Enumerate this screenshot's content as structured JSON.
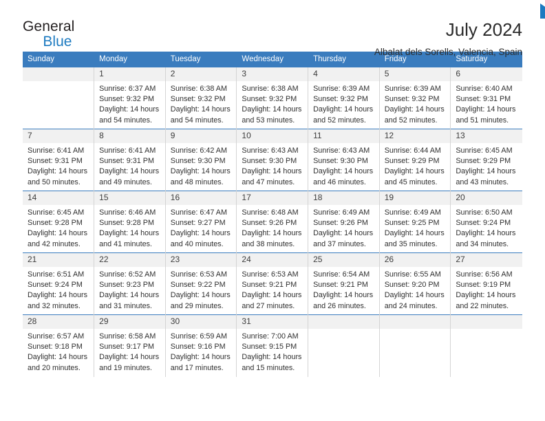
{
  "brand": {
    "name_top": "General",
    "name_bottom": "Blue",
    "triangle_icon": "triangle-icon",
    "color_top": "#231f20",
    "color_bottom": "#1c7ac0"
  },
  "header": {
    "title": "July 2024",
    "subtitle": "Albalat dels Sorells, Valencia, Spain"
  },
  "theme": {
    "header_bar": "#3a7cbe",
    "daynum_band": "#f1f1f1",
    "grid_line": "#d4d4d4",
    "text": "#2f2f2f"
  },
  "weekday_headers": [
    "Sunday",
    "Monday",
    "Tuesday",
    "Wednesday",
    "Thursday",
    "Friday",
    "Saturday"
  ],
  "weeks": [
    [
      {
        "day": "",
        "sunrise": "",
        "sunset": "",
        "daylight_line1": "",
        "daylight_line2": ""
      },
      {
        "day": "1",
        "sunrise": "Sunrise: 6:37 AM",
        "sunset": "Sunset: 9:32 PM",
        "daylight_line1": "Daylight: 14 hours",
        "daylight_line2": "and 54 minutes."
      },
      {
        "day": "2",
        "sunrise": "Sunrise: 6:38 AM",
        "sunset": "Sunset: 9:32 PM",
        "daylight_line1": "Daylight: 14 hours",
        "daylight_line2": "and 54 minutes."
      },
      {
        "day": "3",
        "sunrise": "Sunrise: 6:38 AM",
        "sunset": "Sunset: 9:32 PM",
        "daylight_line1": "Daylight: 14 hours",
        "daylight_line2": "and 53 minutes."
      },
      {
        "day": "4",
        "sunrise": "Sunrise: 6:39 AM",
        "sunset": "Sunset: 9:32 PM",
        "daylight_line1": "Daylight: 14 hours",
        "daylight_line2": "and 52 minutes."
      },
      {
        "day": "5",
        "sunrise": "Sunrise: 6:39 AM",
        "sunset": "Sunset: 9:32 PM",
        "daylight_line1": "Daylight: 14 hours",
        "daylight_line2": "and 52 minutes."
      },
      {
        "day": "6",
        "sunrise": "Sunrise: 6:40 AM",
        "sunset": "Sunset: 9:31 PM",
        "daylight_line1": "Daylight: 14 hours",
        "daylight_line2": "and 51 minutes."
      }
    ],
    [
      {
        "day": "7",
        "sunrise": "Sunrise: 6:41 AM",
        "sunset": "Sunset: 9:31 PM",
        "daylight_line1": "Daylight: 14 hours",
        "daylight_line2": "and 50 minutes."
      },
      {
        "day": "8",
        "sunrise": "Sunrise: 6:41 AM",
        "sunset": "Sunset: 9:31 PM",
        "daylight_line1": "Daylight: 14 hours",
        "daylight_line2": "and 49 minutes."
      },
      {
        "day": "9",
        "sunrise": "Sunrise: 6:42 AM",
        "sunset": "Sunset: 9:30 PM",
        "daylight_line1": "Daylight: 14 hours",
        "daylight_line2": "and 48 minutes."
      },
      {
        "day": "10",
        "sunrise": "Sunrise: 6:43 AM",
        "sunset": "Sunset: 9:30 PM",
        "daylight_line1": "Daylight: 14 hours",
        "daylight_line2": "and 47 minutes."
      },
      {
        "day": "11",
        "sunrise": "Sunrise: 6:43 AM",
        "sunset": "Sunset: 9:30 PM",
        "daylight_line1": "Daylight: 14 hours",
        "daylight_line2": "and 46 minutes."
      },
      {
        "day": "12",
        "sunrise": "Sunrise: 6:44 AM",
        "sunset": "Sunset: 9:29 PM",
        "daylight_line1": "Daylight: 14 hours",
        "daylight_line2": "and 45 minutes."
      },
      {
        "day": "13",
        "sunrise": "Sunrise: 6:45 AM",
        "sunset": "Sunset: 9:29 PM",
        "daylight_line1": "Daylight: 14 hours",
        "daylight_line2": "and 43 minutes."
      }
    ],
    [
      {
        "day": "14",
        "sunrise": "Sunrise: 6:45 AM",
        "sunset": "Sunset: 9:28 PM",
        "daylight_line1": "Daylight: 14 hours",
        "daylight_line2": "and 42 minutes."
      },
      {
        "day": "15",
        "sunrise": "Sunrise: 6:46 AM",
        "sunset": "Sunset: 9:28 PM",
        "daylight_line1": "Daylight: 14 hours",
        "daylight_line2": "and 41 minutes."
      },
      {
        "day": "16",
        "sunrise": "Sunrise: 6:47 AM",
        "sunset": "Sunset: 9:27 PM",
        "daylight_line1": "Daylight: 14 hours",
        "daylight_line2": "and 40 minutes."
      },
      {
        "day": "17",
        "sunrise": "Sunrise: 6:48 AM",
        "sunset": "Sunset: 9:26 PM",
        "daylight_line1": "Daylight: 14 hours",
        "daylight_line2": "and 38 minutes."
      },
      {
        "day": "18",
        "sunrise": "Sunrise: 6:49 AM",
        "sunset": "Sunset: 9:26 PM",
        "daylight_line1": "Daylight: 14 hours",
        "daylight_line2": "and 37 minutes."
      },
      {
        "day": "19",
        "sunrise": "Sunrise: 6:49 AM",
        "sunset": "Sunset: 9:25 PM",
        "daylight_line1": "Daylight: 14 hours",
        "daylight_line2": "and 35 minutes."
      },
      {
        "day": "20",
        "sunrise": "Sunrise: 6:50 AM",
        "sunset": "Sunset: 9:24 PM",
        "daylight_line1": "Daylight: 14 hours",
        "daylight_line2": "and 34 minutes."
      }
    ],
    [
      {
        "day": "21",
        "sunrise": "Sunrise: 6:51 AM",
        "sunset": "Sunset: 9:24 PM",
        "daylight_line1": "Daylight: 14 hours",
        "daylight_line2": "and 32 minutes."
      },
      {
        "day": "22",
        "sunrise": "Sunrise: 6:52 AM",
        "sunset": "Sunset: 9:23 PM",
        "daylight_line1": "Daylight: 14 hours",
        "daylight_line2": "and 31 minutes."
      },
      {
        "day": "23",
        "sunrise": "Sunrise: 6:53 AM",
        "sunset": "Sunset: 9:22 PM",
        "daylight_line1": "Daylight: 14 hours",
        "daylight_line2": "and 29 minutes."
      },
      {
        "day": "24",
        "sunrise": "Sunrise: 6:53 AM",
        "sunset": "Sunset: 9:21 PM",
        "daylight_line1": "Daylight: 14 hours",
        "daylight_line2": "and 27 minutes."
      },
      {
        "day": "25",
        "sunrise": "Sunrise: 6:54 AM",
        "sunset": "Sunset: 9:21 PM",
        "daylight_line1": "Daylight: 14 hours",
        "daylight_line2": "and 26 minutes."
      },
      {
        "day": "26",
        "sunrise": "Sunrise: 6:55 AM",
        "sunset": "Sunset: 9:20 PM",
        "daylight_line1": "Daylight: 14 hours",
        "daylight_line2": "and 24 minutes."
      },
      {
        "day": "27",
        "sunrise": "Sunrise: 6:56 AM",
        "sunset": "Sunset: 9:19 PM",
        "daylight_line1": "Daylight: 14 hours",
        "daylight_line2": "and 22 minutes."
      }
    ],
    [
      {
        "day": "28",
        "sunrise": "Sunrise: 6:57 AM",
        "sunset": "Sunset: 9:18 PM",
        "daylight_line1": "Daylight: 14 hours",
        "daylight_line2": "and 20 minutes."
      },
      {
        "day": "29",
        "sunrise": "Sunrise: 6:58 AM",
        "sunset": "Sunset: 9:17 PM",
        "daylight_line1": "Daylight: 14 hours",
        "daylight_line2": "and 19 minutes."
      },
      {
        "day": "30",
        "sunrise": "Sunrise: 6:59 AM",
        "sunset": "Sunset: 9:16 PM",
        "daylight_line1": "Daylight: 14 hours",
        "daylight_line2": "and 17 minutes."
      },
      {
        "day": "31",
        "sunrise": "Sunrise: 7:00 AM",
        "sunset": "Sunset: 9:15 PM",
        "daylight_line1": "Daylight: 14 hours",
        "daylight_line2": "and 15 minutes."
      },
      {
        "day": "",
        "sunrise": "",
        "sunset": "",
        "daylight_line1": "",
        "daylight_line2": ""
      },
      {
        "day": "",
        "sunrise": "",
        "sunset": "",
        "daylight_line1": "",
        "daylight_line2": ""
      },
      {
        "day": "",
        "sunrise": "",
        "sunset": "",
        "daylight_line1": "",
        "daylight_line2": ""
      }
    ]
  ]
}
